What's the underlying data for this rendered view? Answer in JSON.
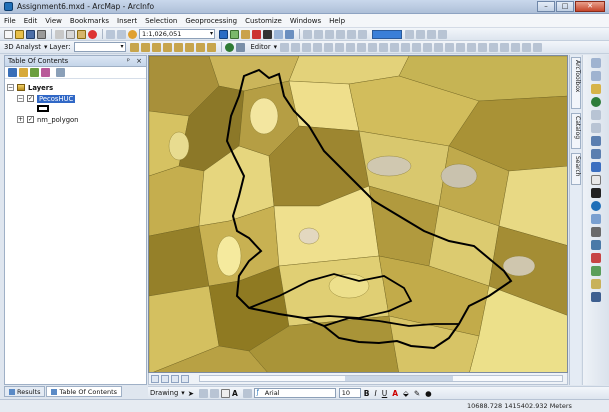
{
  "window": {
    "title": "Assignment6.mxd - ArcMap - ArcInfo",
    "minimize": "–",
    "maximize": "□",
    "close": "✕"
  },
  "menu": [
    "File",
    "Edit",
    "View",
    "Bookmarks",
    "Insert",
    "Selection",
    "Geoprocessing",
    "Customize",
    "Windows",
    "Help"
  ],
  "toolbar": {
    "scale": "1:1,026,051",
    "analyst_label": "3D Analyst",
    "layer_label": "Layer:",
    "editor_label": "Editor"
  },
  "toc": {
    "title": "Table Of Contents",
    "header_buttons": "ᵖ ×",
    "root": "Layers",
    "layers": [
      {
        "name": "PecosHUC",
        "checked": true,
        "selected": true
      },
      {
        "name": "nm_polygon",
        "checked": true,
        "selected": false
      }
    ],
    "tabs": [
      "Results",
      "Table Of Contents"
    ]
  },
  "dock": {
    "tabs": [
      "ArcToolbox",
      "Catalog",
      "Search"
    ]
  },
  "drawing": {
    "label": "Drawing",
    "font": "Arial",
    "size": "10",
    "bold": "B",
    "italic": "I",
    "underline": "U"
  },
  "status": {
    "coordinates": "10688.728  1415402.932 Meters"
  },
  "colors": {
    "accent": "#3168c6",
    "map_fill_dark": "#8f7a22",
    "map_fill_light": "#f0e08a",
    "map_outline": "#000000"
  }
}
